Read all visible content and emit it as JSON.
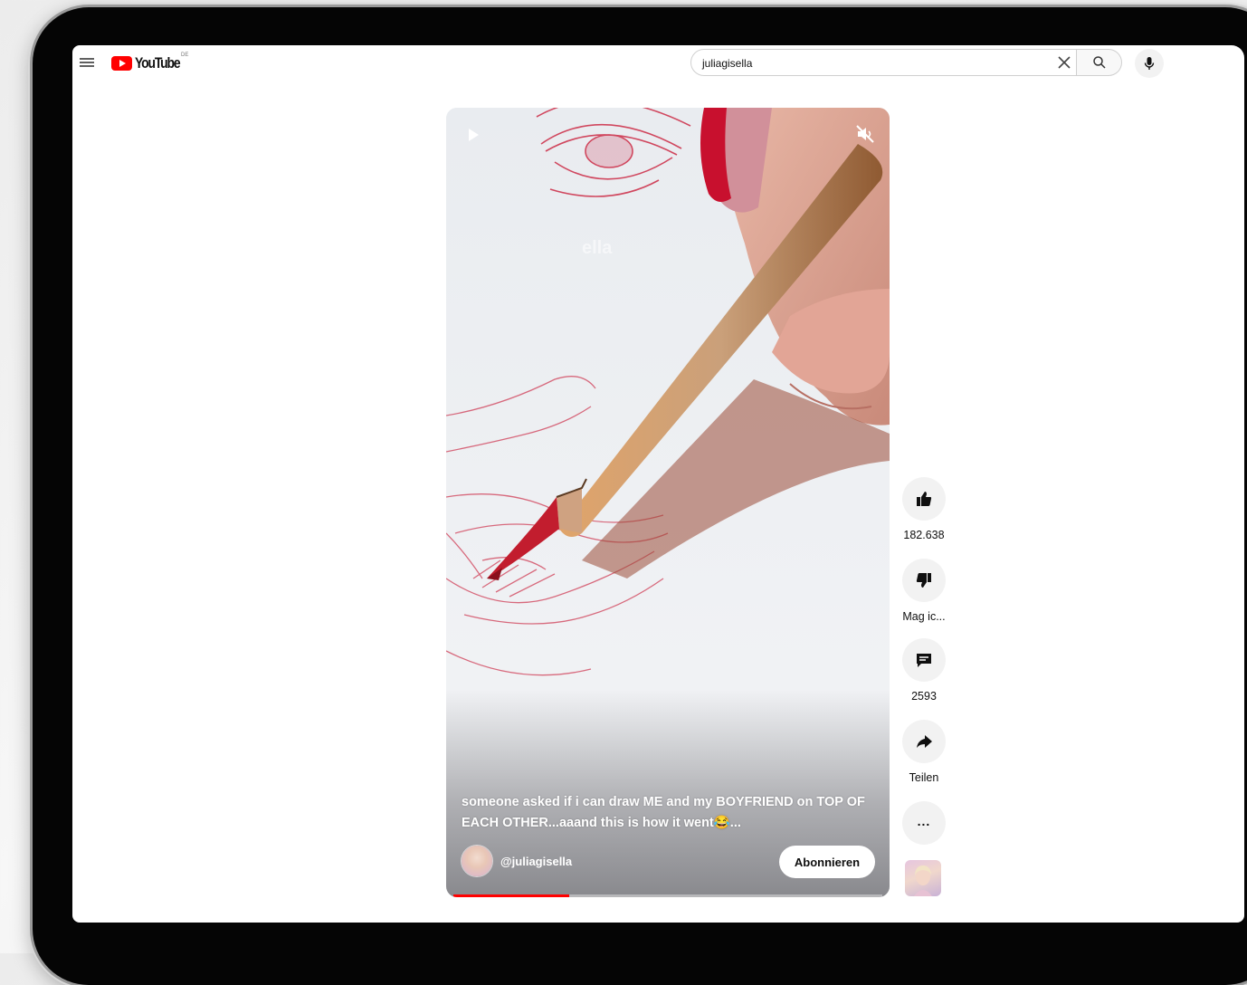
{
  "header": {
    "logo_text": "YouTube",
    "logo_region": "DE",
    "search_value": "juliagisella",
    "icons": [
      "menu-icon",
      "youtube-logo",
      "clear-icon",
      "search-icon",
      "mic-icon"
    ]
  },
  "video": {
    "watermark": "ella",
    "caption": "someone asked if i can draw ME and my BOYFRIEND on TOP OF EACH OTHER...aaand this is how it went😂...",
    "channel_handle": "@juliagisella",
    "subscribe_label": "Abonnieren",
    "progress_fraction": 0.27,
    "icons": [
      "play-icon",
      "mute-icon"
    ]
  },
  "actions": {
    "like_count": "182.638",
    "dislike_label": "Mag ic...",
    "comment_count": "2593",
    "share_label": "Teilen",
    "more_label": "...",
    "icons": [
      "thumb-up-icon",
      "thumb-down-icon",
      "comment-icon",
      "share-icon",
      "more-icon"
    ]
  },
  "colors": {
    "accent": "#ff0000",
    "drawing_red": "#c8102e",
    "frame": "#050505"
  }
}
